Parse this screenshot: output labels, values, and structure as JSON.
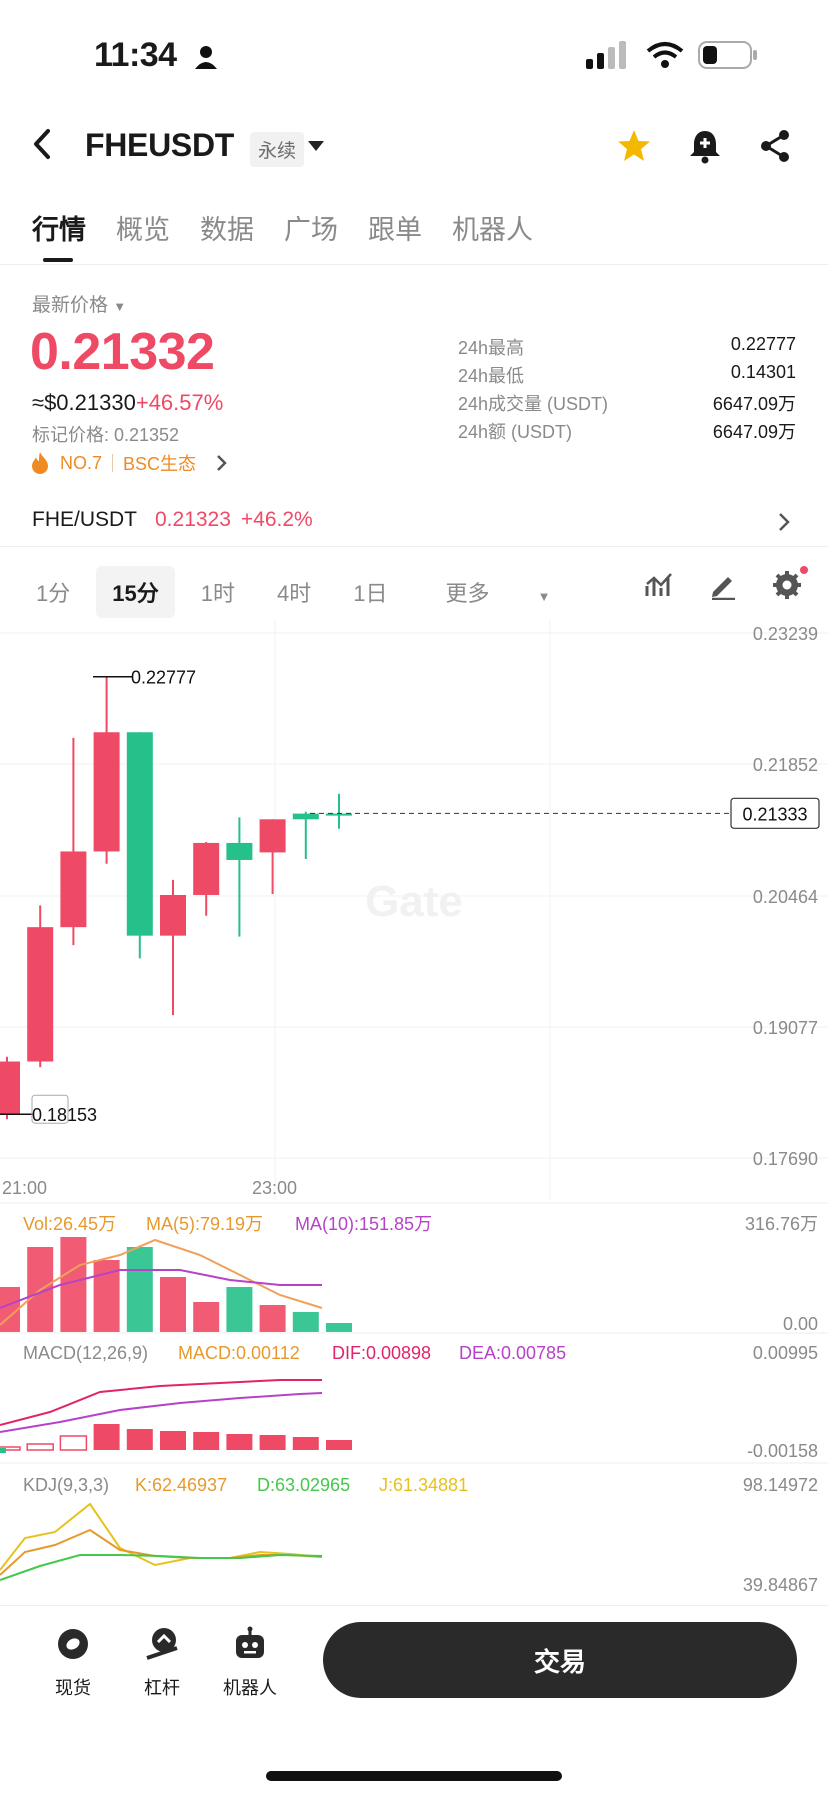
{
  "status": {
    "time": "11:34"
  },
  "header": {
    "pair": "FHEUSDT",
    "badge": "永续"
  },
  "tabs": [
    "行情",
    "概览",
    "数据",
    "广场",
    "跟单",
    "机器人"
  ],
  "price": {
    "latest_label": "最新价格",
    "last": "0.21332",
    "usd": "≈$0.21330",
    "change": "+46.57%",
    "mark": "标记价格: 0.21352",
    "rank": "NO.7",
    "eco": "BSC生态"
  },
  "stats": [
    {
      "k": "24h最高",
      "v": "0.22777"
    },
    {
      "k": "24h最低",
      "v": "0.14301"
    },
    {
      "k": "24h成交量 (USDT)",
      "v": "6647.09万"
    },
    {
      "k": "24h额 (USDT)",
      "v": "6647.09万"
    }
  ],
  "spot": {
    "pair": "FHE/USDT",
    "price": "0.21323",
    "change": "+46.2%"
  },
  "intervals": [
    "1分",
    "15分",
    "1时",
    "4时",
    "1日",
    "更多"
  ],
  "bottom": {
    "spot": "现货",
    "lever": "杠杆",
    "bot": "机器人",
    "trade": "交易"
  },
  "colors": {
    "up": "#ef4a65",
    "down": "#26c08a",
    "accent": "#f5b800"
  },
  "chart_data": {
    "type": "candlestick",
    "y_axis": [
      "0.23239",
      "0.21852",
      "0.20464",
      "0.19077",
      "0.17690"
    ],
    "ylim": [
      0.1769,
      0.23239
    ],
    "x_ticks": [
      "21:00",
      "23:00"
    ],
    "high_marker": "0.22777",
    "low_marker": "0.18153",
    "current_price": "0.21333",
    "candles": [
      {
        "o": 0.1815,
        "c": 0.1871,
        "h": 0.1876,
        "l": 0.181
      },
      {
        "o": 0.1871,
        "c": 0.2013,
        "h": 0.2036,
        "l": 0.1865
      },
      {
        "o": 0.2013,
        "c": 0.2093,
        "h": 0.2213,
        "l": 0.1994
      },
      {
        "o": 0.2093,
        "c": 0.2219,
        "h": 0.2278,
        "l": 0.208
      },
      {
        "o": 0.2219,
        "c": 0.2004,
        "h": 0.2219,
        "l": 0.198
      },
      {
        "o": 0.2004,
        "c": 0.2047,
        "h": 0.2063,
        "l": 0.192
      },
      {
        "o": 0.2047,
        "c": 0.2102,
        "h": 0.2103,
        "l": 0.2025
      },
      {
        "o": 0.2102,
        "c": 0.2084,
        "h": 0.2129,
        "l": 0.2003
      },
      {
        "o": 0.2092,
        "c": 0.2127,
        "h": 0.2127,
        "l": 0.2048
      },
      {
        "o": 0.2133,
        "c": 0.2127,
        "h": 0.2135,
        "l": 0.2085
      },
      {
        "o": 0.2133,
        "c": 0.2132,
        "h": 0.2154,
        "l": 0.2117
      }
    ],
    "volume": {
      "label": "Vol:26.45万",
      "ma5": "MA(5):79.19万",
      "ma10": "MA(10):151.85万",
      "max": "316.76万",
      "min": "0.00",
      "bars": [
        0.45,
        0.85,
        0.95,
        0.72,
        0.85,
        0.55,
        0.3,
        0.45,
        0.27,
        0.2,
        0.09
      ]
    },
    "macd": {
      "label": "MACD(12,26,9)",
      "macd": "MACD:0.00112",
      "dif": "DIF:0.00898",
      "dea": "DEA:0.00785",
      "max": "0.00995",
      "min": "-0.00158"
    },
    "kdj": {
      "label": "KDJ(9,3,3)",
      "k": "K:62.46937",
      "d": "D:63.02965",
      "j": "J:61.34881",
      "max": "98.14972",
      "min": "39.84867"
    }
  }
}
